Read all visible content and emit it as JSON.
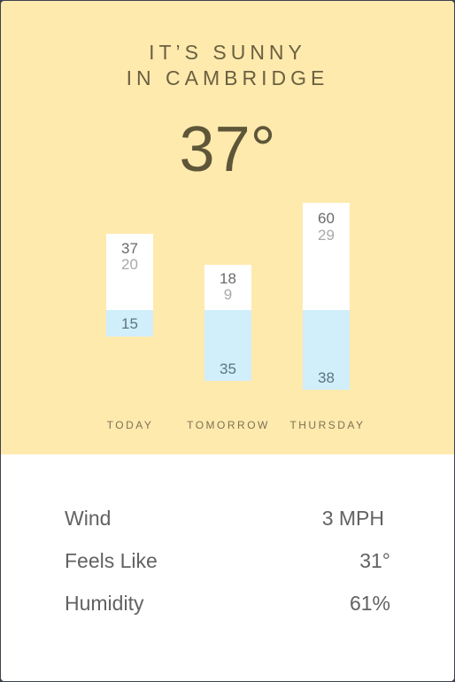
{
  "theme": {
    "sky_color": "#ffeaae",
    "bar_past_color": "#d1eefb",
    "bar_forecast_color": "#ffffff"
  },
  "header": {
    "line1": "IT’S SUNNY",
    "line2": "IN CAMBRIDGE"
  },
  "current": {
    "temperature": "37°"
  },
  "forecast": [
    {
      "day": "TODAY",
      "high": "37",
      "low": "20",
      "past": "15"
    },
    {
      "day": "TOMORROW",
      "high": "18",
      "low": "9",
      "past": "35"
    },
    {
      "day": "THURSDAY",
      "high": "60",
      "low": "29",
      "past": "38"
    }
  ],
  "details": [
    {
      "label": "Wind",
      "value": "3 MPH"
    },
    {
      "label": "Feels Like",
      "value": "31°"
    },
    {
      "label": "Humidity",
      "value": "61%"
    }
  ]
}
